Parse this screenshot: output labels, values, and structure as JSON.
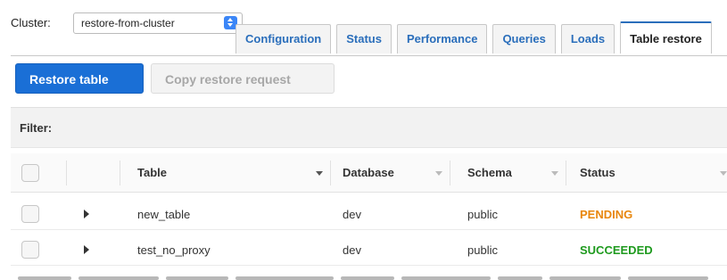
{
  "cluster": {
    "label": "Cluster:",
    "selected": "restore-from-cluster"
  },
  "tabs": [
    {
      "label": "Configuration"
    },
    {
      "label": "Status"
    },
    {
      "label": "Performance"
    },
    {
      "label": "Queries"
    },
    {
      "label": "Loads"
    },
    {
      "label": "Table restore"
    }
  ],
  "active_tab": "Table restore",
  "actions": {
    "restore_label": "Restore table",
    "copy_label": "Copy restore request"
  },
  "filter": {
    "label": "Filter:"
  },
  "table": {
    "columns": [
      "Table",
      "Database",
      "Schema",
      "Status"
    ],
    "rows": [
      {
        "table": "new_table",
        "database": "dev",
        "schema": "public",
        "status": "PENDING"
      },
      {
        "table": "test_no_proxy",
        "database": "dev",
        "schema": "public",
        "status": "SUCCEEDED"
      }
    ]
  },
  "colors": {
    "primary": "#1a6fd6",
    "link": "#2a6ebb",
    "pending": "#e8860c",
    "succeeded": "#1e9a1e"
  }
}
